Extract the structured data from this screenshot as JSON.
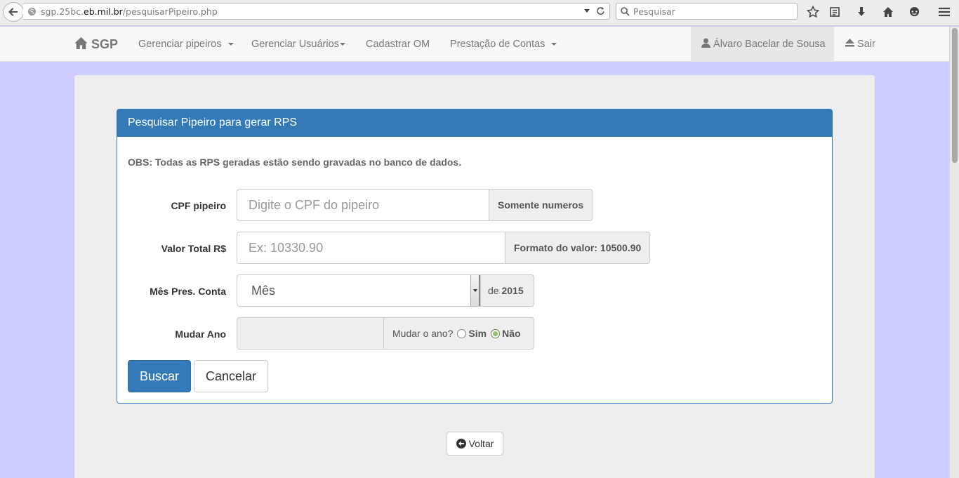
{
  "browser": {
    "url_prefix": "sgp.25bc.",
    "url_host": "eb.mil.br",
    "url_path": "/pesquisarPipeiro.php",
    "search_placeholder": "Pesquisar"
  },
  "navbar": {
    "brand": "SGP",
    "items": [
      {
        "label": "Gerenciar pipeiros"
      },
      {
        "label": "Gerenciar Usuários"
      },
      {
        "label": "Cadastrar OM"
      },
      {
        "label": "Prestação de Contas"
      }
    ],
    "user": "Álvaro Bacelar de Sousa",
    "logout": "Sair"
  },
  "panel": {
    "title": "Pesquisar Pipeiro para gerar RPS",
    "obs": "OBS: Todas as RPS geradas estão sendo gravadas no banco de dados."
  },
  "form": {
    "cpf": {
      "label": "CPF pipeiro",
      "placeholder": "Digite o CPF do pipeiro",
      "addon": "Somente numeros"
    },
    "valor": {
      "label": "Valor Total R$",
      "placeholder": "Ex: 10330.90",
      "addon_prefix": "Formato do valor: ",
      "addon_value": "10500.90"
    },
    "mes": {
      "label": "Mês Pres. Conta",
      "selected": "Mês",
      "addon_prefix": "de ",
      "year": "2015"
    },
    "ano": {
      "label": "Mudar Ano",
      "question": "Mudar o ano?",
      "option_yes": "Sim",
      "option_no": "Não",
      "selected": "Não"
    }
  },
  "buttons": {
    "search": "Buscar",
    "cancel": "Cancelar",
    "back": "Voltar"
  },
  "colors": {
    "primary": "#337ab7",
    "page_background": "#ccccff"
  }
}
